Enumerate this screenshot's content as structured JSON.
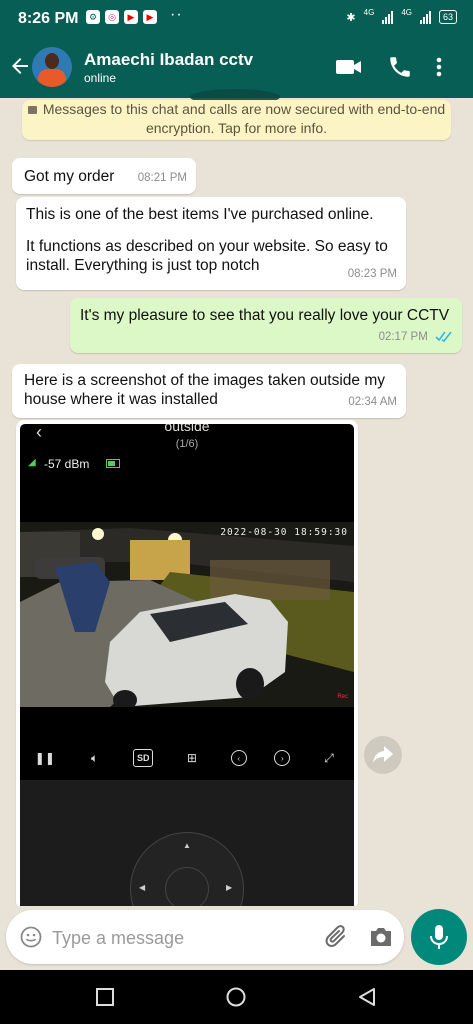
{
  "status_bar": {
    "time": "8:26 PM",
    "app_icons": [
      "settings-icon",
      "instagram-icon",
      "youtube-icon",
      "youtube-icon"
    ],
    "more_dots": "··",
    "network1": "4G",
    "network2": "4G",
    "battery": "63"
  },
  "header": {
    "contact_name": "Amaechi Ibadan cctv",
    "status": "online"
  },
  "encryption_notice": "Messages to this chat and calls are now secured with end-to-end encryption. Tap for more info.",
  "messages": [
    {
      "direction": "in",
      "text": "Got my order",
      "time": "08:21 PM"
    },
    {
      "direction": "in",
      "text_lines": [
        "This is one of the best items I've purchased online.",
        "",
        "It functions as described on your website. So easy to install. Everything is just top notch"
      ],
      "time": "08:23 PM"
    },
    {
      "direction": "out",
      "text": "It's my pleasure to see that you really love your CCTV",
      "time": "02:17 PM",
      "read": true
    },
    {
      "direction": "in",
      "text": "Here is a screenshot of the images taken outside my house where it was installed",
      "time": "02:34 AM"
    }
  ],
  "image_message": {
    "title": "outside",
    "page": "(1/6)",
    "signal": "-57 dBm",
    "timestamp": "2022-08-30 18:59:30",
    "rec_label": "Rec",
    "controls": [
      "pause-icon",
      "mute-icon",
      "SD",
      "grid-icon",
      "prev-icon",
      "next-icon",
      "fullscreen-icon"
    ]
  },
  "input": {
    "placeholder": "Type a message"
  },
  "colors": {
    "header": "#075e54",
    "outgoing_bubble": "#dcf8c6",
    "incoming_bubble": "#ffffff",
    "mic_button": "#00897b",
    "read_ticks": "#34b7f1"
  }
}
